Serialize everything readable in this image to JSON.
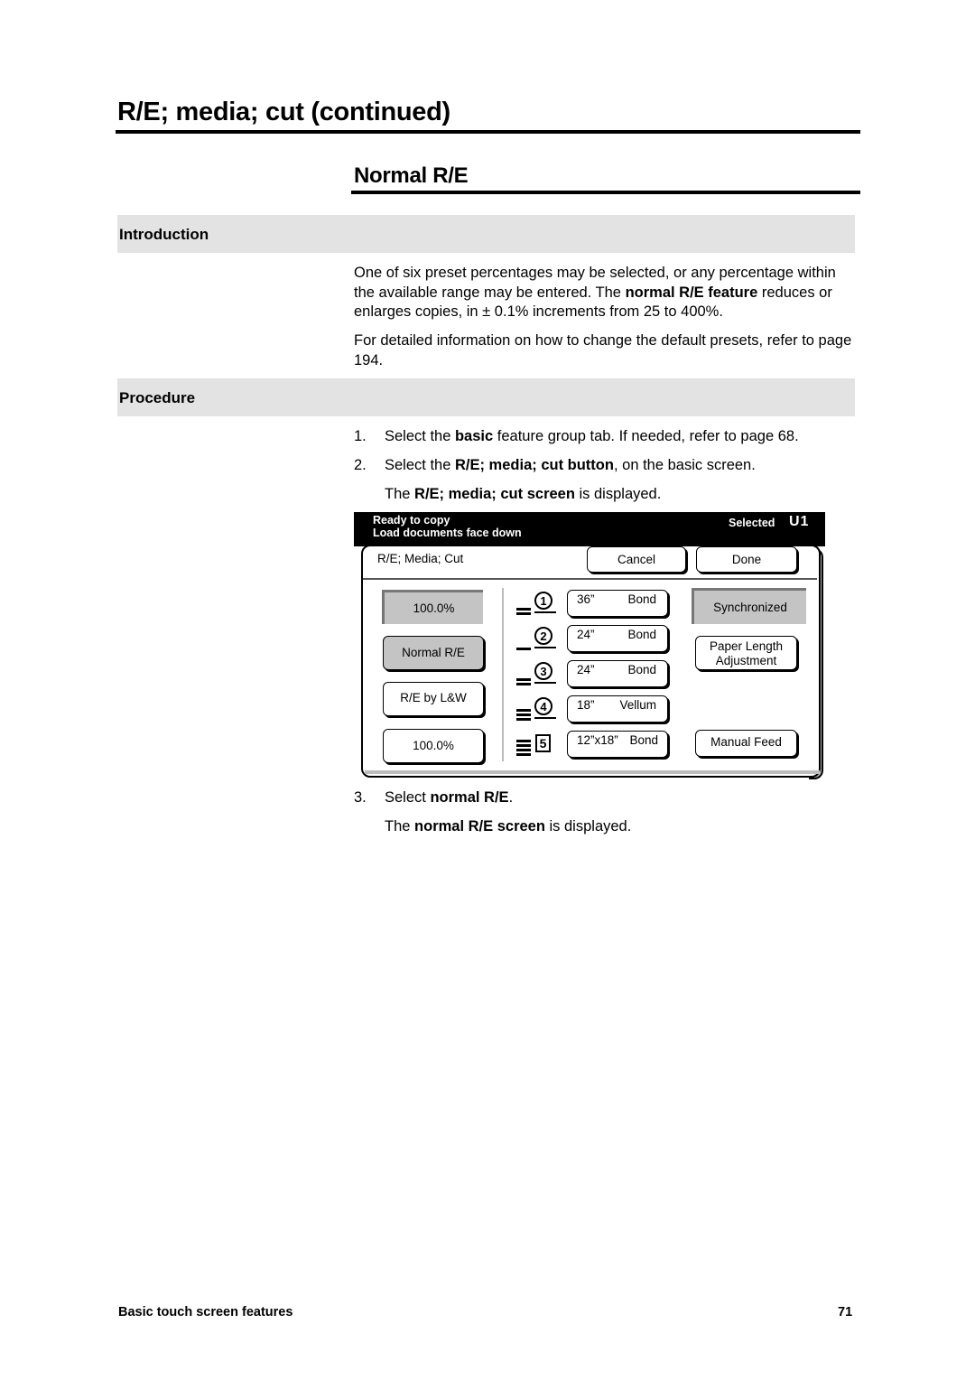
{
  "page": {
    "title": "R/E; media; cut (continued)",
    "section_title": "Normal R/E",
    "footer_left": "Basic touch screen features",
    "page_number": "71"
  },
  "introduction": {
    "heading": "Introduction",
    "p1_a": "One of six preset percentages may be selected, or any percentage within the available range may be entered.  The ",
    "p1_bold": "normal R/E feature",
    "p1_b": " reduces or enlarges copies, in ± 0.1% increments from 25 to 400%.",
    "p2": "For detailed information on how to change the default presets, refer to page 194."
  },
  "procedure": {
    "heading": "Procedure",
    "steps": [
      {
        "num": "1.",
        "a": "Select the ",
        "bold": "basic",
        "b": " feature group tab.  If needed, refer to page 68."
      },
      {
        "num": "2.",
        "a": "Select the ",
        "bold": "R/E; media; cut button",
        "b": ", on the basic screen."
      },
      {
        "num": "3.",
        "a": "Select ",
        "bold": "normal R/E",
        "b": "."
      }
    ],
    "result2": {
      "a": "The ",
      "bold": "R/E; media; cut screen",
      "b": " is displayed."
    },
    "result3": {
      "a": "The ",
      "bold": "normal R/E screen",
      "b": " is displayed."
    }
  },
  "screen": {
    "status_line1": "Ready to copy",
    "status_line2": "Load documents face down",
    "selected_label": "Selected",
    "selected_value": "U1",
    "screen_name": "R/E; Media; Cut",
    "cancel": "Cancel",
    "done": "Done",
    "left_buttons": {
      "percent_display": "100.0%",
      "normal_re": "Normal R/E",
      "re_by_lw": "R/E by L&W",
      "percent_button": "100.0%"
    },
    "trays": [
      {
        "id": "1",
        "size": "36”",
        "media": "Bond",
        "bars": 2,
        "icon": "circle"
      },
      {
        "id": "2",
        "size": "24”",
        "media": "Bond",
        "bars": 1,
        "icon": "circle"
      },
      {
        "id": "3",
        "size": "24”",
        "media": "Bond",
        "bars": 2,
        "icon": "circle"
      },
      {
        "id": "4",
        "size": "18”",
        "media": "Vellum",
        "bars": 3,
        "icon": "circle"
      },
      {
        "id": "5",
        "size": "12”x18”",
        "media": "Bond",
        "bars": 4,
        "icon": "square"
      }
    ],
    "right_buttons": {
      "synchronized": "Synchronized",
      "paper_length_1": "Paper Length",
      "paper_length_2": "Adjustment",
      "manual_feed": "Manual Feed"
    }
  }
}
